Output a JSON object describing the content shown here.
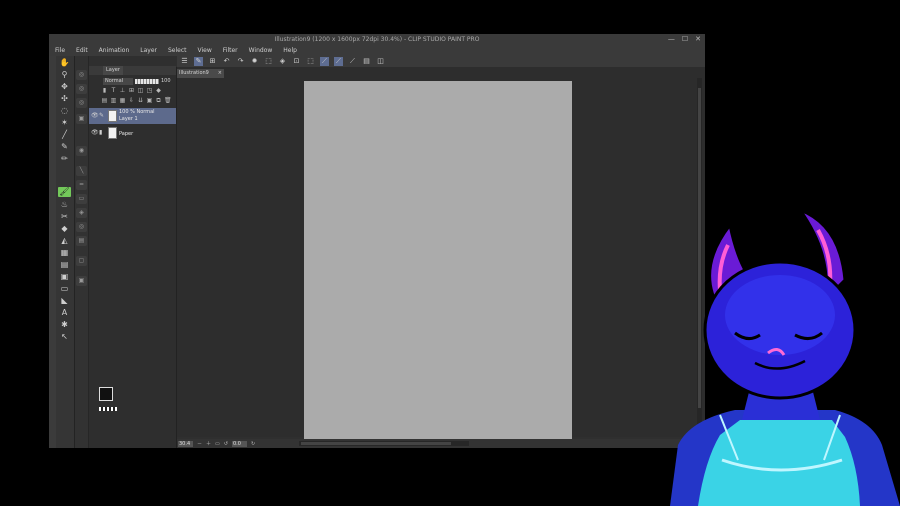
{
  "window": {
    "title": "Illustration9 (1200 x 1600px 72dpi 30.4%) - CLIP STUDIO PAINT PRO",
    "controls": [
      "—",
      "☐",
      "✕"
    ]
  },
  "menu": [
    "File",
    "Edit",
    "Animation",
    "Layer",
    "Select",
    "View",
    "Filter",
    "Window",
    "Help"
  ],
  "layer_panel": {
    "tab_label": "Layer",
    "blend_mode": "Normal",
    "opacity": "100",
    "layers": [
      {
        "line1": "100 % Normal",
        "line2": "Layer 1",
        "selected": true
      },
      {
        "line1": "",
        "line2": "Paper",
        "selected": false
      }
    ]
  },
  "document": {
    "tab_label": "Illustration9",
    "close_glyph": "×"
  },
  "status": {
    "zoom": "30.4",
    "rotation": "0.0"
  },
  "colors": {
    "foreground": "#111111",
    "background": "#ff2a6a",
    "accent_tool": "#73c95a",
    "selected_layer": "#5d6a8c",
    "canvas": "#ababab"
  }
}
